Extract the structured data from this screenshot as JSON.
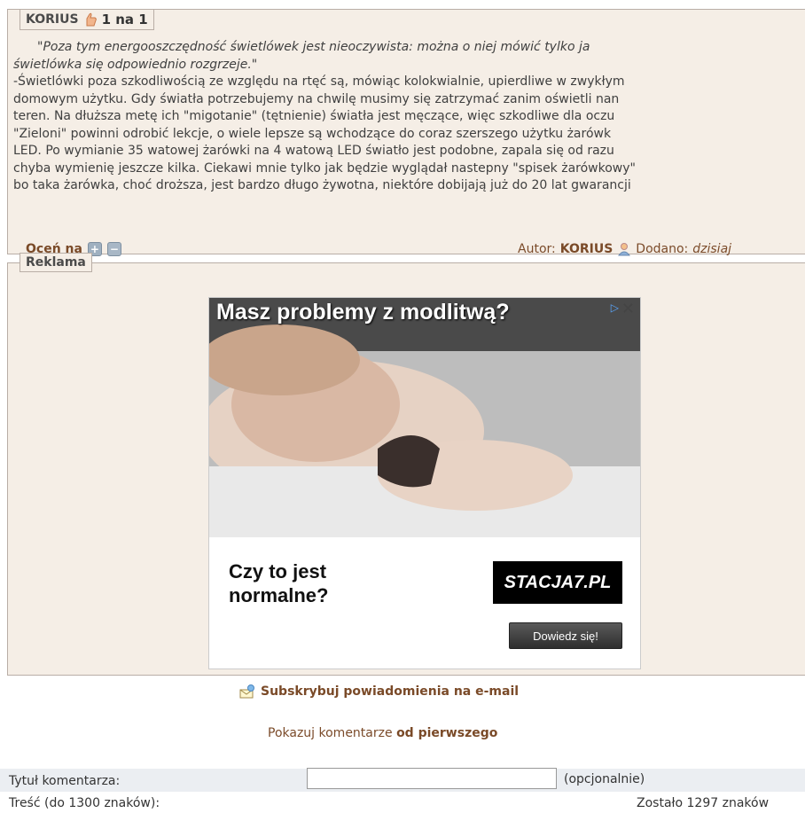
{
  "comment": {
    "author": "KORIUS",
    "score": "1 na 1",
    "quote_line1": "\"Poza tym energooszczędność świetlówek jest nieoczywista: można o niej mówić tylko ja",
    "quote_line2": "świetlówka się odpowiednio rozgrzeje.\"",
    "lines": [
      "-Świetlówki poza szkodliwością ze względu na rtęć są, mówiąc kolokwialnie, upierdliwe w zwykłym",
      "domowym użytku. Gdy światła potrzebujemy na chwilę musimy się zatrzymać zanim oświetli nan",
      "teren.  Na dłuższa metę ich \"migotanie\" (tętnienie) światła jest męczące, więc szkodliwe dla oczu",
      "\"Zieloni\" powinni odrobić lekcje, o wiele lepsze są wchodzące do coraz szerszego użytku żarówk",
      "LED. Po wymianie 35 watowej żarówki na 4 watową LED światło jest podobne, zapala się od razu",
      "chyba wymienię jeszcze kilka. Ciekawi mnie tylko jak będzie wyglądał nastepny \"spisek żarówkowy\"",
      "bo taka żarówka, choć droższa, jest bardzo długo żywotna, niektóre dobijają już do 20 lat gwarancji"
    ],
    "rate_label": "Oceń na",
    "author_label": "Autor:",
    "author_name": "KORIUS",
    "added_label": "Dodano:",
    "added_value": "dzisiaj"
  },
  "ad_section": {
    "legend": "Reklama",
    "headline": "Masz problemy z modlitwą?",
    "cta_text": "Czy to jest normalne?",
    "logo": "STACJA7.PL",
    "button": "Dowiedz się!"
  },
  "subscribe": "Subskrybuj powiadomienia na e-mail",
  "order": {
    "prefix": "Pokazuj komentarze",
    "link": "od pierwszego"
  },
  "form": {
    "title_label": "Tytuł komentarza:",
    "title_value": "",
    "optional": "(opcjonalnie)",
    "body_label": "Treść (do 1300 znaków):",
    "remaining": "Zostało 1297  znaków"
  }
}
